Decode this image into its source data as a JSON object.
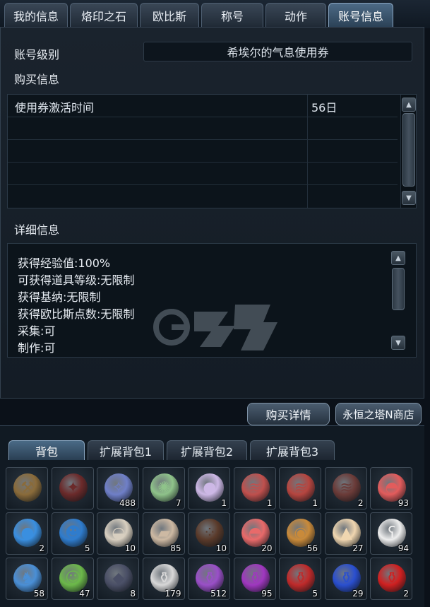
{
  "tabs": [
    "我的信息",
    "烙印之石",
    "欧比斯",
    "称号",
    "动作",
    "账号信息"
  ],
  "account": {
    "grade_label": "账号级别",
    "grade_value": "希埃尔的气息使用券",
    "purchase_label": "购买信息",
    "purchase_rows": [
      {
        "name": "使用券激活时间",
        "value": "56日"
      },
      {
        "name": "",
        "value": ""
      },
      {
        "name": "",
        "value": ""
      },
      {
        "name": "",
        "value": ""
      },
      {
        "name": "",
        "value": ""
      }
    ],
    "detail_label": "详细信息",
    "details": [
      "获得经验值:100%",
      "可获得道具等级:无限制",
      "获得基纳:无限制",
      "获得欧比斯点数:无限制",
      "采集:可",
      "制作:可"
    ],
    "buttons": {
      "detail": "购买详情",
      "shop": "永恒之塔N商店"
    }
  },
  "inventory": {
    "tabs": [
      "背包",
      "扩展背包1",
      "扩展背包2",
      "扩展背包3"
    ],
    "slots": [
      {
        "icon": "mace-icon",
        "glyph": "⚒",
        "color": "#8a6b3a",
        "qty": ""
      },
      {
        "icon": "spear-icon",
        "glyph": "✦",
        "color": "#6b2a2a",
        "qty": ""
      },
      {
        "icon": "crystal-shard-icon",
        "glyph": "✧",
        "color": "#6f7fc8",
        "qty": "488"
      },
      {
        "icon": "green-orb-cluster-icon",
        "glyph": "✺",
        "color": "#8fc38a",
        "qty": "7"
      },
      {
        "icon": "pearl-orb-icon",
        "glyph": "●",
        "color": "#cdb8e6",
        "qty": "1"
      },
      {
        "icon": "red-meat-icon",
        "glyph": "≋",
        "color": "#c0504d",
        "qty": "1"
      },
      {
        "icon": "red-meat-icon",
        "glyph": "≋",
        "color": "#b6453f",
        "qty": "1"
      },
      {
        "icon": "red-meat-icon",
        "glyph": "≋",
        "color": "#6b3b38",
        "qty": "2"
      },
      {
        "icon": "red-jelly-icon",
        "glyph": "◓",
        "color": "#e25c5c",
        "qty": "93"
      },
      {
        "icon": "blue-orb-icon",
        "glyph": "●",
        "color": "#3a8fe0",
        "qty": "2"
      },
      {
        "icon": "blue-creature-icon",
        "glyph": "☻",
        "color": "#2f7ccd",
        "qty": "5"
      },
      {
        "icon": "rice-bowl-icon",
        "glyph": "◒",
        "color": "#d8cfc0",
        "qty": "10"
      },
      {
        "icon": "bread-icon",
        "glyph": "▰",
        "color": "#cdb9a3",
        "qty": "85"
      },
      {
        "icon": "chocolate-balls-icon",
        "glyph": "⁘",
        "color": "#5a3a2a",
        "qty": "10"
      },
      {
        "icon": "red-jelly-icon",
        "glyph": "◓",
        "color": "#e86a6a",
        "qty": "20"
      },
      {
        "icon": "food-bowl-icon",
        "glyph": "◉",
        "color": "#c98a3a",
        "qty": "56"
      },
      {
        "icon": "cake-icon",
        "glyph": "▲",
        "color": "#f0d6b0",
        "qty": "27"
      },
      {
        "icon": "polar-bear-icon",
        "glyph": "ʕ",
        "color": "#eeeeee",
        "qty": "94"
      },
      {
        "icon": "blue-dragon-icon",
        "glyph": "♞",
        "color": "#4a8fd6",
        "qty": "58"
      },
      {
        "icon": "green-creature-icon",
        "glyph": "☺",
        "color": "#6cb84a",
        "qty": "47"
      },
      {
        "icon": "dark-crystal-icon",
        "glyph": "◆",
        "color": "#4a4f66",
        "qty": "8"
      },
      {
        "icon": "white-potion-icon",
        "glyph": "⚱",
        "color": "#d8d8d8",
        "qty": "179"
      },
      {
        "icon": "purple-potion-icon",
        "glyph": "⚱",
        "color": "#9a4fc8",
        "qty": "512"
      },
      {
        "icon": "purple-potion-icon",
        "glyph": "⚱",
        "color": "#a037c0",
        "qty": "95"
      },
      {
        "icon": "red-potion-icon",
        "glyph": "⚱",
        "color": "#c02a2a",
        "qty": "5"
      },
      {
        "icon": "blue-potion-icon",
        "glyph": "⚱",
        "color": "#2a4fd0",
        "qty": "29"
      },
      {
        "icon": "red-potion-icon",
        "glyph": "⚱",
        "color": "#d02020",
        "qty": "2"
      }
    ]
  }
}
